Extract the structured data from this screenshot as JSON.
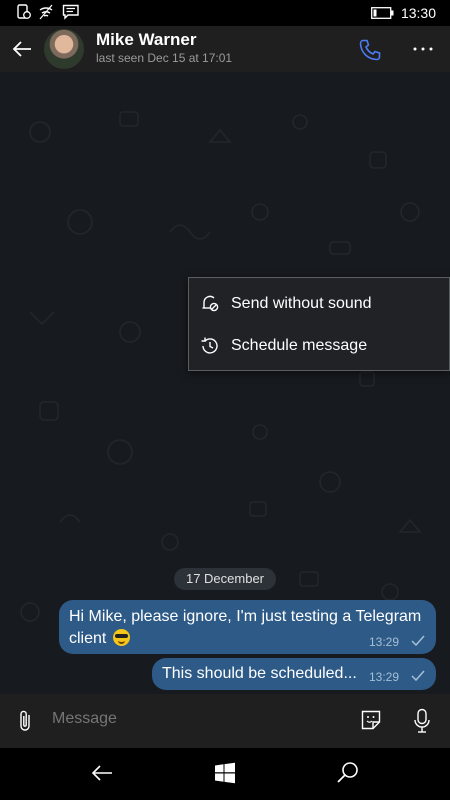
{
  "status_bar": {
    "time": "13:30"
  },
  "chat_header": {
    "name": "Mike Warner",
    "last_seen": "last seen Dec 15 at 17:01"
  },
  "popup_menu": {
    "items": [
      {
        "label": "Send without sound",
        "icon": "silent-bell-icon"
      },
      {
        "label": "Schedule message",
        "icon": "clock-history-icon"
      }
    ]
  },
  "date_divider": "17 December",
  "messages": [
    {
      "text": "Hi Mike, please ignore, I'm just testing a Telegram",
      "text2": "client",
      "emoji": "sunglasses-emoji",
      "time": "13:29",
      "status": "read"
    },
    {
      "text": "This should be scheduled...",
      "time": "13:29",
      "status": "read"
    }
  ],
  "input": {
    "placeholder": "Message"
  },
  "colors": {
    "accent": "#4a7cf3",
    "bubble": "#2d5a87",
    "chat_bg": "#171b1f",
    "header_bg": "#1f1f1f"
  }
}
